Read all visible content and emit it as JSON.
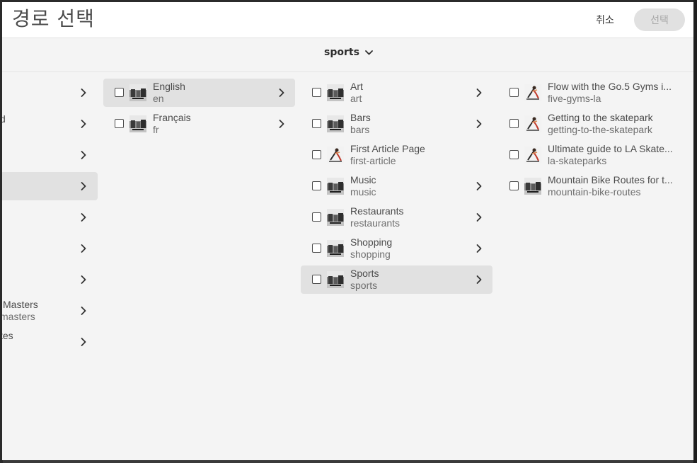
{
  "dialog": {
    "title": "경로 선택",
    "cancel_label": "취소",
    "select_label": "선택"
  },
  "breadcrumb": {
    "label": "sports"
  },
  "column1": {
    "items": [
      {
        "title": "",
        "subtitle": ""
      },
      {
        "title": "d",
        "subtitle": ""
      },
      {
        "title": "",
        "subtitle": ""
      },
      {
        "title": "",
        "subtitle": ""
      },
      {
        "title": "",
        "subtitle": ""
      },
      {
        "title": "",
        "subtitle": ""
      },
      {
        "title": "",
        "subtitle": ""
      },
      {
        "title": "Masters",
        "subtitle": "masters"
      },
      {
        "title": "tes",
        "subtitle": ""
      }
    ]
  },
  "column2": {
    "items": [
      {
        "title": "English",
        "subtitle": "en",
        "selected": true
      },
      {
        "title": "Français",
        "subtitle": "fr",
        "selected": false
      }
    ]
  },
  "column3": {
    "items": [
      {
        "title": "Art",
        "subtitle": "art",
        "thumb": "street-thumbnail",
        "chevron": true
      },
      {
        "title": "Bars",
        "subtitle": "bars",
        "thumb": "street-thumbnail",
        "chevron": true
      },
      {
        "title": "First Article Page",
        "subtitle": "first-article",
        "thumb": "skater-thumbnail",
        "chevron": false
      },
      {
        "title": "Music",
        "subtitle": "music",
        "thumb": "street-thumbnail",
        "chevron": true
      },
      {
        "title": "Restaurants",
        "subtitle": "restaurants",
        "thumb": "street-thumbnail",
        "chevron": true
      },
      {
        "title": "Shopping",
        "subtitle": "shopping",
        "thumb": "street-thumbnail",
        "chevron": true
      },
      {
        "title": "Sports",
        "subtitle": "sports",
        "thumb": "street-thumbnail",
        "chevron": true,
        "selected": true
      }
    ]
  },
  "column4": {
    "items": [
      {
        "title": "Flow with the Go.5 Gyms i...",
        "subtitle": "five-gyms-la",
        "thumb": "skater-thumbnail"
      },
      {
        "title": "Getting to the skatepark",
        "subtitle": "getting-to-the-skatepark",
        "thumb": "skater-thumbnail"
      },
      {
        "title": "Ultimate guide to LA Skate...",
        "subtitle": "la-skateparks",
        "thumb": "skater-thumbnail"
      },
      {
        "title": "Mountain Bike Routes for t...",
        "subtitle": "mountain-bike-routes",
        "thumb": "street-thumbnail"
      }
    ]
  },
  "colors": {
    "dialog_bg": "#f4f4f4",
    "header_bg": "#ffffff",
    "selected_row": "#e1e1e1",
    "text_primary": "#4b4b4b",
    "text_secondary": "#6e6e6e",
    "disabled_button": "#e1e1e1"
  }
}
